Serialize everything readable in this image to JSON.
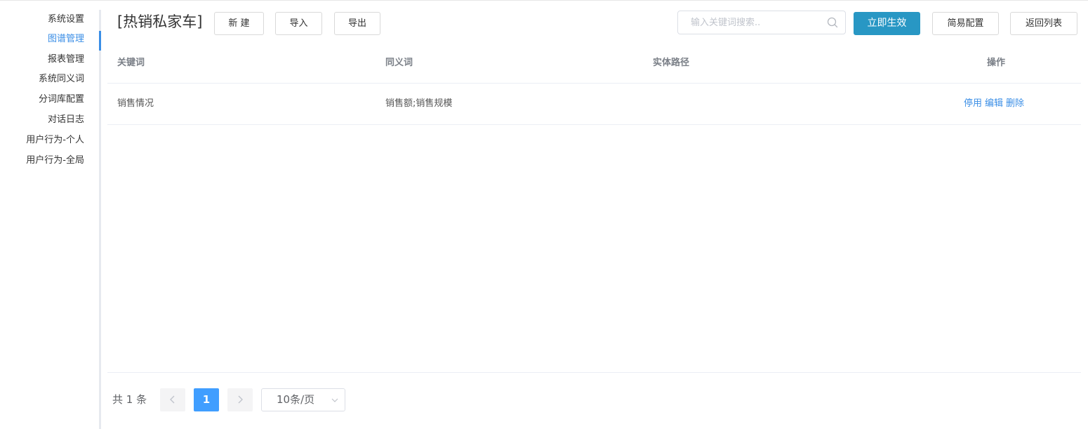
{
  "sidebar": {
    "items": [
      {
        "label": "系统设置",
        "active": false
      },
      {
        "label": "图谱管理",
        "active": true
      },
      {
        "label": "报表管理",
        "active": false
      },
      {
        "label": "系统同义词",
        "active": false
      },
      {
        "label": "分词库配置",
        "active": false
      },
      {
        "label": "对话日志",
        "active": false
      },
      {
        "label": "用户行为-个人",
        "active": false
      },
      {
        "label": "用户行为-全局",
        "active": false
      }
    ]
  },
  "header": {
    "title": "[热销私家车]",
    "new_label": "新 建",
    "import_label": "导入",
    "export_label": "导出",
    "search_placeholder": "输入关键词搜索..",
    "apply_label": "立即生效",
    "simple_config_label": "简易配置",
    "back_label": "返回列表"
  },
  "table": {
    "columns": [
      "关键词",
      "同义词",
      "实体路径",
      "操作"
    ],
    "rows": [
      {
        "keyword": "销售情况",
        "synonyms": "销售额;销售规模",
        "entity_path": "",
        "actions": [
          "停用",
          "编辑",
          "删除"
        ]
      }
    ]
  },
  "pagination": {
    "total_text": "共 1 条",
    "current_page": "1",
    "page_size": "10条/页"
  },
  "colors": {
    "accent": "#3a8ee6",
    "primary_button": "#2897c4",
    "active_page": "#409eff"
  }
}
